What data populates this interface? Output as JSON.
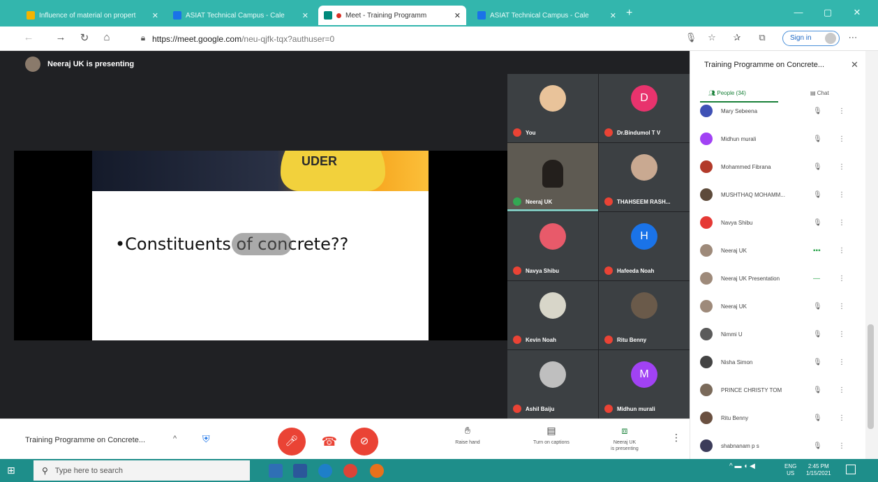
{
  "browser": {
    "tabs": [
      {
        "title": "Influence of material on propert",
        "favicon_color": "#f4b400",
        "active": false
      },
      {
        "title": "ASIAT Technical Campus - Cale",
        "favicon_color": "#1a73e8",
        "active": false
      },
      {
        "title": "Meet - Training Programm",
        "favicon_color": "#00897b",
        "active": true
      },
      {
        "title": "ASIAT Technical Campus - Cale",
        "favicon_color": "#1a73e8",
        "active": false
      }
    ],
    "url_domain": "https://meet.google.com",
    "url_path": "/neu-qjfk-tqx?authuser=0",
    "sign_in_label": "Sign in"
  },
  "meet": {
    "presenter_status": "Neeraj UK is presenting",
    "slide": {
      "headline": "•Constituents of concrete??",
      "helmet_text": "UDER"
    },
    "tiles": [
      {
        "name": "You",
        "avatar_letter": "",
        "avatar_color": "#e9c39a",
        "mic_on": false,
        "video": false
      },
      {
        "name": "Dr.Bindumol T V",
        "avatar_letter": "D",
        "avatar_color": "#e8336d",
        "mic_on": false,
        "video": false
      },
      {
        "name": "Neeraj UK",
        "avatar_letter": "",
        "avatar_color": "#231f1c",
        "mic_on": true,
        "video": true
      },
      {
        "name": "THAHSEEM RASH...",
        "avatar_letter": "",
        "avatar_color": "#c9a991",
        "mic_on": false,
        "video": false
      },
      {
        "name": "Navya Shibu",
        "avatar_letter": "",
        "avatar_color": "#e85a6a",
        "mic_on": false,
        "video": false
      },
      {
        "name": "Hafeeda Noah",
        "avatar_letter": "H",
        "avatar_color": "#1a73e8",
        "mic_on": false,
        "video": false
      },
      {
        "name": "Kevin Noah",
        "avatar_letter": "",
        "avatar_color": "#d8d6c9",
        "mic_on": false,
        "video": false
      },
      {
        "name": "Ritu Benny",
        "avatar_letter": "",
        "avatar_color": "#6a5a4a",
        "mic_on": false,
        "video": false
      },
      {
        "name": "Ashil Baiju",
        "avatar_letter": "",
        "avatar_color": "#bfbfbf",
        "mic_on": false,
        "video": false
      },
      {
        "name": "Midhun murali",
        "avatar_letter": "M",
        "avatar_color": "#a142f4",
        "mic_on": false,
        "video": false
      }
    ],
    "bottom": {
      "meeting_title": "Training Programme on Concrete...",
      "raise_hand": "Raise hand",
      "captions": "Turn on captions",
      "presenting_line1": "Neeraj UK",
      "presenting_line2": "is presenting"
    }
  },
  "panel": {
    "title": "Training Programme on Concrete...",
    "tab_people": "People (34)",
    "tab_chat": "Chat",
    "participants": [
      {
        "name": "Mary Sebeena",
        "avatar_color": "#3f51b5",
        "mic": "off"
      },
      {
        "name": "Midhun murali",
        "avatar_color": "#a142f4",
        "mic": "off"
      },
      {
        "name": "Mohammed Fibrana",
        "avatar_color": "#b23a2a",
        "mic": "off"
      },
      {
        "name": "MUSHTHAQ MOHAMM...",
        "avatar_color": "#5d4a3a",
        "mic": "off"
      },
      {
        "name": "Navya Shibu",
        "avatar_color": "#e53935",
        "mic": "off"
      },
      {
        "name": "Neeraj UK",
        "avatar_color": "#9e8a7a",
        "mic": "live"
      },
      {
        "name": "Neeraj UK Presentation",
        "avatar_color": "#9e8a7a",
        "mic": "present"
      },
      {
        "name": "Neeraj UK",
        "avatar_color": "#9e8a7a",
        "mic": "off"
      },
      {
        "name": "Nimmi U",
        "avatar_color": "#5a5a5a",
        "mic": "off"
      },
      {
        "name": "Nisha Simon",
        "avatar_color": "#444444",
        "mic": "off"
      },
      {
        "name": "PRINCE CHRISTY TOM",
        "avatar_color": "#7a6a5a",
        "mic": "off"
      },
      {
        "name": "Ritu Benny",
        "avatar_color": "#6a5040",
        "mic": "off"
      },
      {
        "name": "shabnanam p s",
        "avatar_color": "#3c3c5a",
        "mic": "off"
      }
    ]
  },
  "taskbar": {
    "search_placeholder": "Type here to search",
    "lang_line1": "ENG",
    "lang_line2": "US",
    "time": "2:45 PM",
    "date": "1/15/2021"
  }
}
